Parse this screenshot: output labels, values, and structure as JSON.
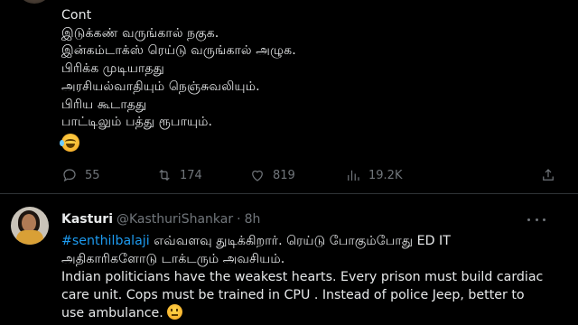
{
  "tweet1": {
    "lines": [
      "Cont",
      "இடுக்கண் வருங்கால் நகுக.",
      "இன்கம்டாக்ஸ் ரெய்டு வருங்கால் அழுக.",
      "பிரிக்க முடியாதது",
      "அரசியல்வாதியும் நெஞ்சுவலியும்.",
      "பிரிய கூடாதது",
      "பாட்டிலும் பத்து ரூபாயும்."
    ],
    "emoji": "face-with-tears-of-joy",
    "stats": {
      "replies": "55",
      "retweets": "174",
      "likes": "819",
      "views": "19.2K"
    }
  },
  "tweet2": {
    "name": "Kasturi",
    "handle": "@KasthuriShankar",
    "separator": "·",
    "time": "8h",
    "hashtag": "#senthilbalaji",
    "line1_rest": " எவ்வளவு துடிக்கிறார். ரெய்டு போகும்போது ED IT",
    "line2": "அதிகாரிகளோடு டாக்டரும் அவசியம்.",
    "line3": "Indian politicians have the weakest hearts.  Every prison must build cardiac",
    "line4": "care unit. Cops must be trained in CPU . Instead of police Jeep, better to",
    "line5": "use ambulance. ",
    "emoji": "confused-face"
  },
  "colors": {
    "background": "#000000",
    "text": "#e7e9ea",
    "muted": "#71767b",
    "link": "#1d9bf0",
    "divider": "#2f3336"
  }
}
